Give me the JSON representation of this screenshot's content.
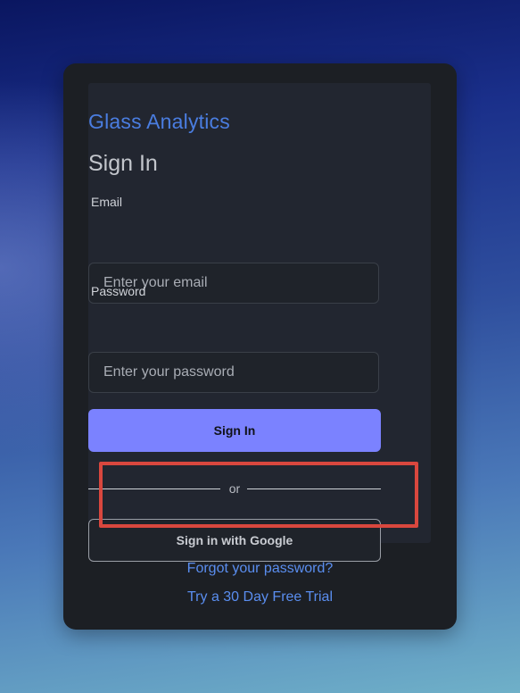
{
  "brand": "Glass Analytics",
  "form": {
    "title": "Sign In",
    "email_label": "Email",
    "email_placeholder": "Enter your email",
    "password_label": "Password",
    "password_placeholder": "Enter your password",
    "signin_label": "Sign In",
    "divider_text": "or",
    "google_label": "Sign in with Google"
  },
  "links": {
    "forgot": "Forgot your password?",
    "trial": "Try a 30 Day Free Trial"
  },
  "colors": {
    "accent": "#7b82ff",
    "brand": "#4a7de0",
    "link": "#5a8ef0",
    "highlight": "#d9473e"
  }
}
